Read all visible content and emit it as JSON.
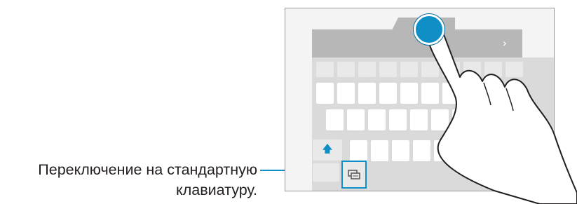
{
  "callout": {
    "line1": "Переключение на стандартную",
    "line2": "клавиатуру."
  },
  "keyboard": {
    "toolbar_chevron": "›",
    "shift_glyph": "🡅"
  },
  "icons": {
    "mode_switch": "keyboard-mode-icon",
    "shift": "shift-arrow-icon",
    "hand": "pointing-hand-icon",
    "touch": "touch-point-icon"
  },
  "colors": {
    "accent": "#0f8fc6",
    "text": "#231f20",
    "frame": "#9a9a9a"
  }
}
